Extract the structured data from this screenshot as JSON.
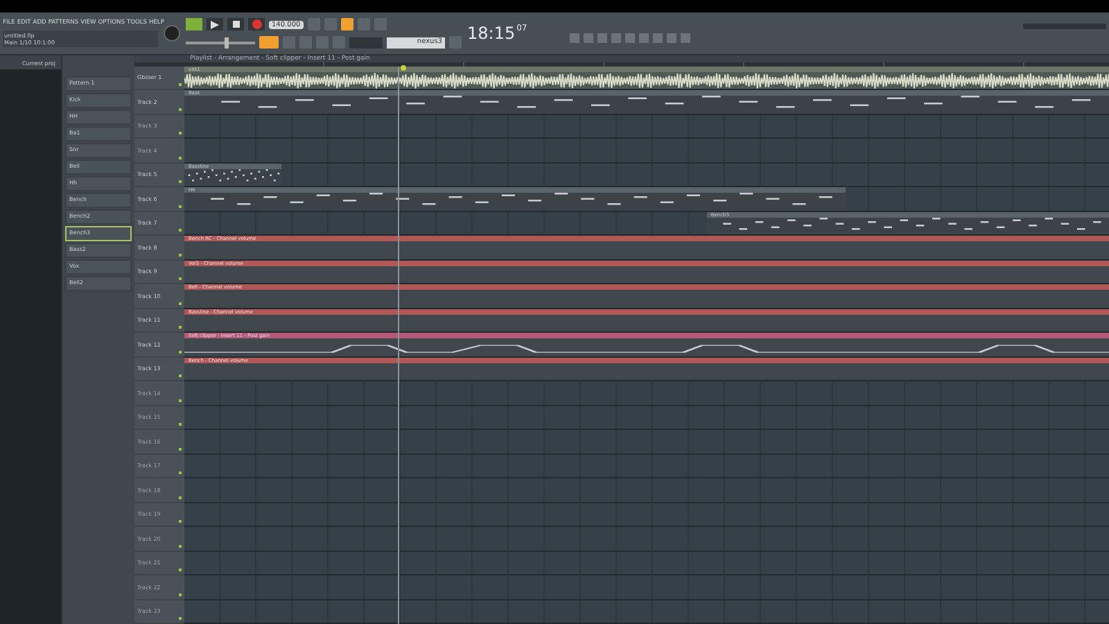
{
  "menu": [
    "FILE",
    "EDIT",
    "ADD",
    "PATTERNS",
    "VIEW",
    "OPTIONS",
    "TOOLS",
    "HELP"
  ],
  "project": {
    "file": "untitled.flp",
    "info": "Main 1/10  10:1:00"
  },
  "transport": {
    "tempo": "140.000",
    "time": "18:15",
    "time_small": "07",
    "pattern": "nexus3"
  },
  "master_slider": {
    "level": 0.55
  },
  "hint": "Playlist - Arrangement - Soft clipper - Insert 11 - Post gain",
  "browser": {
    "title": "Current proj"
  },
  "picker": [
    {
      "label": "Pattern 1",
      "selected": false
    },
    {
      "label": "Kick",
      "selected": false
    },
    {
      "label": "HH",
      "selected": false
    },
    {
      "label": "Ba1",
      "selected": false
    },
    {
      "label": "Snr",
      "selected": false
    },
    {
      "label": "Bell",
      "selected": false
    },
    {
      "label": "Hh",
      "selected": false
    },
    {
      "label": "Bench",
      "selected": false
    },
    {
      "label": "Bench2",
      "selected": false
    },
    {
      "label": "Bench3",
      "selected": true
    },
    {
      "label": "Bass2",
      "selected": false
    },
    {
      "label": "Vox",
      "selected": false
    },
    {
      "label": "Bell2",
      "selected": false
    }
  ],
  "tracks": [
    {
      "name": "Gbsser 1",
      "clips": [
        {
          "kind": "audio",
          "label": "vox1"
        }
      ]
    },
    {
      "name": "Track 2",
      "clips": [
        {
          "kind": "pattern",
          "label": "Beat"
        }
      ]
    },
    {
      "name": "Track 3"
    },
    {
      "name": "Track 4"
    },
    {
      "name": "Track 5",
      "clips": [
        {
          "kind": "short",
          "label": "Bassline"
        }
      ]
    },
    {
      "name": "Track 6",
      "clips": [
        {
          "kind": "left",
          "label": "Hh"
        }
      ]
    },
    {
      "name": "Track 7",
      "clips": [
        {
          "kind": "right",
          "label": "Bench3"
        }
      ]
    },
    {
      "name": "Track 8",
      "clips": [
        {
          "kind": "automation",
          "label": "Bench RC - Channel volume"
        }
      ]
    },
    {
      "name": "Track 9",
      "clips": [
        {
          "kind": "automation",
          "label": "Vol3 - Channel volume"
        }
      ]
    },
    {
      "name": "Track 10",
      "clips": [
        {
          "kind": "automation",
          "label": "Bell - Channel volume"
        }
      ]
    },
    {
      "name": "Track 11",
      "clips": [
        {
          "kind": "automation",
          "label": "Bassline - Channel volume"
        }
      ]
    },
    {
      "name": "Track 12",
      "clips": [
        {
          "kind": "curve",
          "label": "Soft clipper - Insert 11 - Post gain"
        }
      ]
    },
    {
      "name": "Track 13",
      "clips": [
        {
          "kind": "automation",
          "label": "Bench - Channel volume"
        }
      ]
    },
    {
      "name": "Track 14"
    },
    {
      "name": "Track 15"
    },
    {
      "name": "Track 16"
    },
    {
      "name": "Track 17"
    },
    {
      "name": "Track 18"
    },
    {
      "name": "Track 19"
    },
    {
      "name": "Track 20"
    },
    {
      "name": "Track 21"
    },
    {
      "name": "Track 22"
    },
    {
      "name": "Track 23"
    }
  ]
}
